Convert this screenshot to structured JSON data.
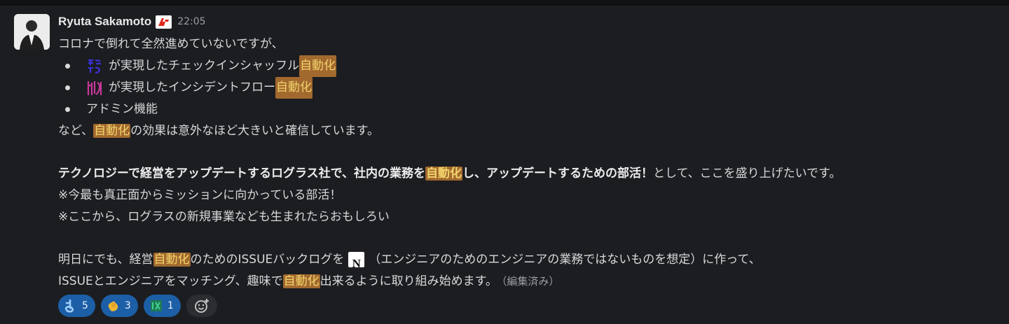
{
  "message": {
    "author": "Ryuta Sakamoto",
    "timestamp": "22:05",
    "status_badge_icon": "company-logo-icon",
    "lines": {
      "l1": "コロナで倒れて全然進めていないですが、",
      "b1_pre": "が実現したチェックインシャッフル",
      "b2_pre": "が実現したインシデントフロー",
      "b3": "アドミン機能",
      "l2_pre": "など、",
      "l2_post": "の効果は意外なほど大きいと確信しています。",
      "l3_bold_a": "テクノロジーで経営をアップデートするログラス社で、社内の業務を",
      "l3_bold_b": "し、アップデートするための部活！",
      "l3_rest": "として、ここを盛り上げたいです。",
      "l4": "※今最も真正面からミッションに向かっている部活！",
      "l5": "※ここから、ログラスの新規事業なども生まれたらおもしろい",
      "l6_a": "明日にでも、経営",
      "l6_b": "のためのISSUEバックログを",
      "l6_c": "（エンジニアのためのエンジニアの業務ではないものを想定）に作って、",
      "l7_a": "ISSUEとエンジニアをマッチング、趣味で",
      "l7_b": "出来るように取り組み始めます。",
      "edited": "（編集済み）"
    },
    "highlight_word": "自動化",
    "notion_letter": "N",
    "custom_emoji": [
      "custom-emoji-sugoi-icon",
      "custom-emoji-pink-icon"
    ]
  },
  "reactions": [
    {
      "icon": "yo-emoji-icon",
      "count": "5"
    },
    {
      "icon": "clap-emoji-icon",
      "count": "3"
    },
    {
      "icon": "custom-green-emoji-icon",
      "count": "1"
    }
  ],
  "add_reaction_icon": "add-reaction-icon",
  "colors": {
    "background": "#1b1d21",
    "highlight_bg": "#a2692f",
    "highlight_text": "#f2d46b",
    "reaction_bg": "#1d5fa6"
  }
}
